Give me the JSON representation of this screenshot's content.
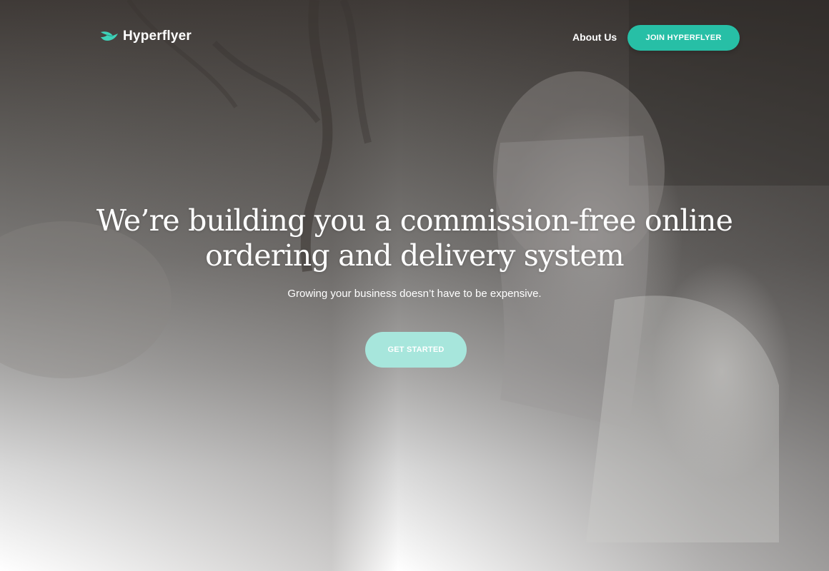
{
  "brand": {
    "name": "Hyperflyer",
    "accent_color": "#27bfa6",
    "logo_icon": "bird-wing-icon"
  },
  "nav": {
    "about_label": "About Us",
    "join_label": "JOIN HYPERFLYER"
  },
  "hero": {
    "headline_line1": "We’re building you a commission-free online",
    "headline_line2": "ordering and delivery system",
    "subheadline": "Growing your business doesn’t have to be expensive.",
    "cta_label": "GET STARTED",
    "cta_color": "#a7e6dc",
    "background_image": "woman-with-phone-photo"
  }
}
